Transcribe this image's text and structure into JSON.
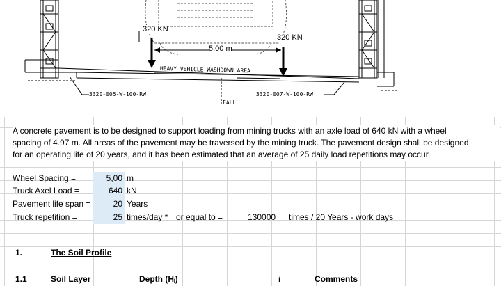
{
  "drawing": {
    "load_left": "320 KN",
    "load_right": "320 KN",
    "spacing_label": "5.00 m",
    "area_label": "HEAVY VEHICLE WASHDOWN AREA",
    "ref_left": "3320-005-W-100-RW",
    "ref_right": "3320-007-W-100-RW",
    "fall_label": "FALL"
  },
  "description": {
    "line1": "A concrete pavement is to be designed to support loading from mining trucks with an axle load of 640 kN with a wheel",
    "line2": "spacing of 4.97 m. All areas of the pavement may be traversed by the mining truck. The pavement design shall be designed",
    "line3": " for an operating life of 20 years, and it has been estimated that an average of 25 daily load repetitions may occur."
  },
  "params": {
    "wheel_spacing": {
      "label": "Wheel Spacing =",
      "value": "5,00",
      "unit": "m"
    },
    "axle_load": {
      "label": "Truck Axel Load =",
      "value": "640",
      "unit": "kN"
    },
    "life_span": {
      "label": "Pavement life span =",
      "value": "20",
      "unit": "Years"
    },
    "repetition": {
      "label": "Truck repetition =",
      "value": "25",
      "unit": "times/day *",
      "equal_label": "or equal to =",
      "total": "130000",
      "total_unit": "times / 20 Years -  work days"
    }
  },
  "section": {
    "number": "1.",
    "title": "The Soil Profile ",
    "sub_number": "1.1",
    "headers": {
      "layer": "Soil Layer",
      "depth": "Depth (Hᵢ)",
      "i": "i",
      "comments": "Comments"
    }
  }
}
